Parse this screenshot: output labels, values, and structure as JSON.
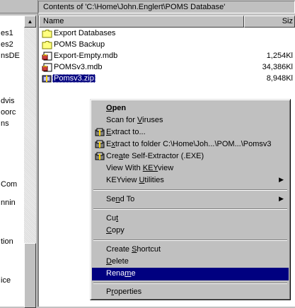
{
  "left_pane": {
    "fragments": [
      "es1",
      "es2",
      "nsDE",
      "dvis",
      "oorc",
      "ns",
      "Com",
      "nnin",
      "tion",
      "ice"
    ],
    "scroll_up": "▲"
  },
  "path_bar": {
    "text": "Contents of 'C:\\Home\\John.Englert\\POMS Database'"
  },
  "columns": {
    "name": "Name",
    "size": "Siz"
  },
  "files": [
    {
      "icon": "folder-icon",
      "name": "Export Databases",
      "size": ""
    },
    {
      "icon": "folder-icon",
      "name": "POMS Backup",
      "size": ""
    },
    {
      "icon": "access-db-icon",
      "name": "Export-Empty.mdb",
      "size": "1,254Kl"
    },
    {
      "icon": "access-db-icon",
      "name": "POMSv3.mdb",
      "size": "34,386Kl"
    },
    {
      "icon": "zip-icon",
      "name": "Pomsv3.zip",
      "size": "8,948Kl",
      "selected": true
    }
  ],
  "context_menu": {
    "items": [
      {
        "label": "Open",
        "bold": true,
        "mn": "O"
      },
      {
        "label": "Scan for Viruses",
        "mn": "V"
      },
      {
        "label": "Extract to...",
        "icon": "winzip-icon",
        "mn": "E"
      },
      {
        "label": "Extract to folder C:\\Home\\Joh...\\POM...\\Pomsv3",
        "icon": "winzip-icon",
        "mn": "x"
      },
      {
        "label": "Create Self-Extractor (.EXE)",
        "icon": "winzip-icon",
        "mn": "a"
      },
      {
        "label": "View With KEYview",
        "mn": "KEY"
      },
      {
        "label": "KEYview Utilities",
        "submenu": true,
        "mn": "U"
      },
      {
        "label": "Send To",
        "submenu": true,
        "mn": "n"
      },
      {
        "label": "Cut",
        "mn": "t"
      },
      {
        "label": "Copy",
        "mn": "C"
      },
      {
        "label": "Create Shortcut",
        "mn": "S"
      },
      {
        "label": "Delete",
        "mn": "D"
      },
      {
        "label": "Rename",
        "highlighted": true,
        "mn": "m"
      },
      {
        "label": "Properties",
        "mn": "r"
      }
    ]
  },
  "colors": {
    "selection": "#000080",
    "face": "#c0c0c0"
  }
}
